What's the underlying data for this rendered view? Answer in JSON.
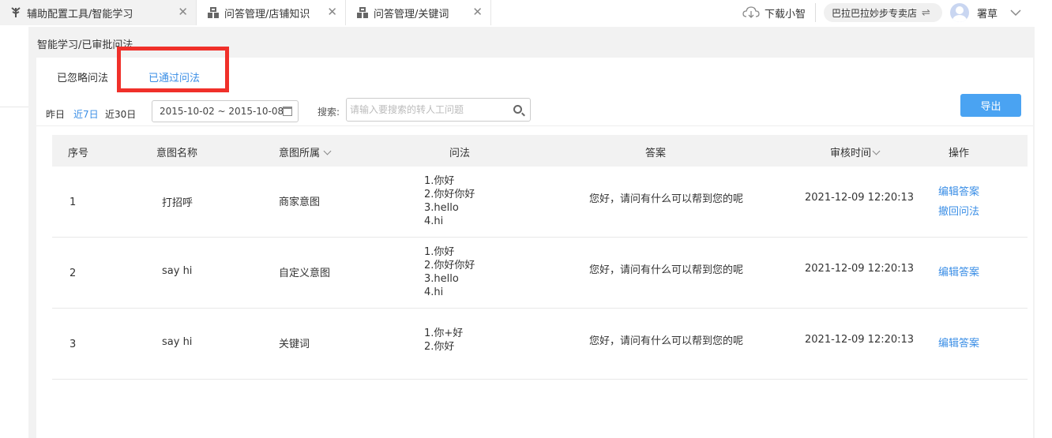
{
  "tabs": [
    {
      "label": "辅助配置工具/智能学习",
      "active": true
    },
    {
      "label": "问答管理/店铺知识",
      "active": false
    },
    {
      "label": "问答管理/关键词",
      "active": false
    }
  ],
  "topbar": {
    "download_label": "下载小智",
    "shop_name": "巴拉巴拉妙步专卖店",
    "user_name": "署草"
  },
  "breadcrumb": "智能学习/已审批问法",
  "subtabs": {
    "ignored": "已忽略问法",
    "passed": "已通过问法"
  },
  "filters": {
    "ranges": [
      "昨日",
      "近7日",
      "近30日"
    ],
    "active_range": "近7日",
    "date_range": "2015-10-02 ~ 2015-10-08",
    "search_label": "搜索:",
    "search_placeholder": "请输入要搜索的转人工问题",
    "export_label": "导出"
  },
  "table": {
    "headers": [
      "序号",
      "意图名称",
      "意图所属",
      "问法",
      "答案",
      "审核时间",
      "操作"
    ],
    "rows": [
      {
        "index": "1",
        "intent": "打招呼",
        "belongs": "商家意图",
        "questions": "1.你好\n2.你好你好\n3.hello\n4.hi",
        "answer": "您好，请问有什么可以帮到您的呢",
        "time": "2021-12-09 12:20:13",
        "actions": [
          "编辑答案",
          "撤回问法"
        ]
      },
      {
        "index": "2",
        "intent": "say hi",
        "belongs": "自定义意图",
        "questions": "1.你好\n2.你好你好\n3.hello\n4.hi",
        "answer": "您好，请问有什么可以帮到您的呢",
        "time": "2021-12-09 12:20:13",
        "actions": [
          "编辑答案"
        ]
      },
      {
        "index": "3",
        "intent": "say hi",
        "belongs": "关键词",
        "questions": "1.你+好\n2.你好",
        "answer": "您好，请问有什么可以帮到您的呢",
        "time": "2021-12-09 12:20:13",
        "actions": [
          "编辑答案"
        ]
      }
    ]
  },
  "colors": {
    "accent": "#3a8ee6",
    "highlight_box": "#f0302a",
    "export_bg": "#4aa3f2"
  },
  "icons": [
    "app-logo-icon",
    "robot-icon",
    "close-icon",
    "cloud-download-icon",
    "swap-icon",
    "avatar",
    "chevron-down-icon",
    "calendar-icon",
    "search-icon"
  ]
}
